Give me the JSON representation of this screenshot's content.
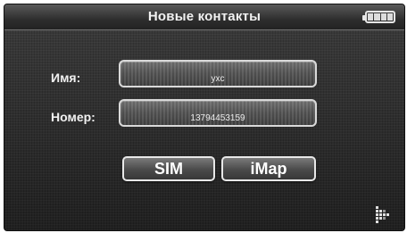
{
  "header": {
    "title": "Новые контакты",
    "battery_icon": "battery-icon"
  },
  "form": {
    "name_label": "Имя:",
    "name_value": "yxc",
    "number_label": "Номер:",
    "number_value": "13794453159"
  },
  "buttons": {
    "sim_label": "SIM",
    "imap_label": "iMap"
  },
  "nav": {
    "next_icon": "next-arrow-icon"
  },
  "colors": {
    "background": "#2b2b2b",
    "text": "#f0f0f0",
    "border": "#d9d9d9"
  }
}
